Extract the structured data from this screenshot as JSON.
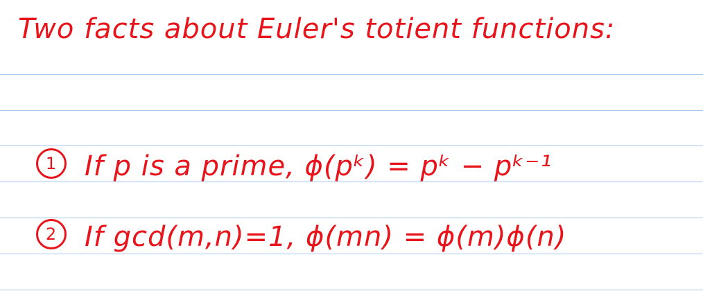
{
  "title": "Two facts about Euler's totient functions:",
  "facts": [
    {
      "number": "1",
      "text": "If p is a prime, ϕ(pᵏ) = pᵏ − pᵏ⁻¹"
    },
    {
      "number": "2",
      "text": "If gcd(m,n)=1, ϕ(mn) = ϕ(m)ϕ(n)"
    }
  ],
  "colors": {
    "ink": "#e8141b",
    "rule_lines": "#a9c8ec",
    "paper": "#ffffff"
  }
}
